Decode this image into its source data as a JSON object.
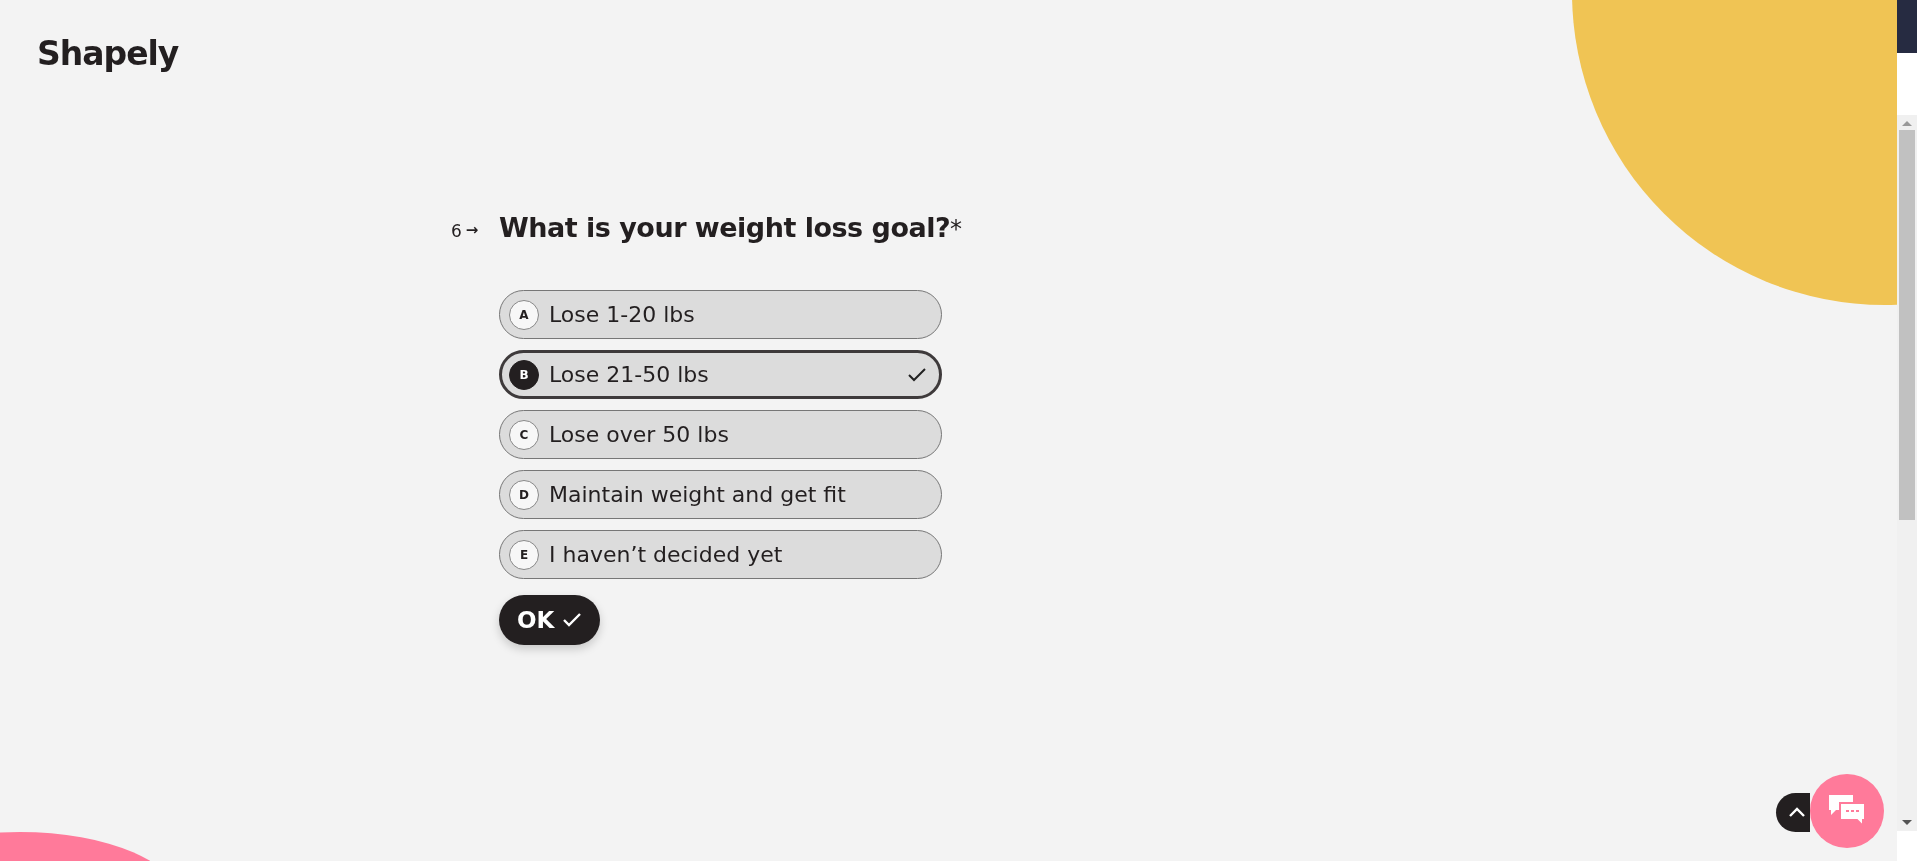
{
  "logo": "Shapely",
  "question": {
    "number": "6",
    "arrow": "→",
    "text": "What is your weight loss goal?",
    "required_mark": "*",
    "options": [
      {
        "letter": "A",
        "label": "Lose 1-20 lbs",
        "selected": false
      },
      {
        "letter": "B",
        "label": "Lose 21-50 lbs",
        "selected": true
      },
      {
        "letter": "C",
        "label": "Lose over 50 lbs",
        "selected": false
      },
      {
        "letter": "D",
        "label": "Maintain weight and get fit",
        "selected": false
      },
      {
        "letter": "E",
        "label": "I haven’t decided yet",
        "selected": false
      }
    ]
  },
  "ok_button": {
    "label": "OK"
  }
}
